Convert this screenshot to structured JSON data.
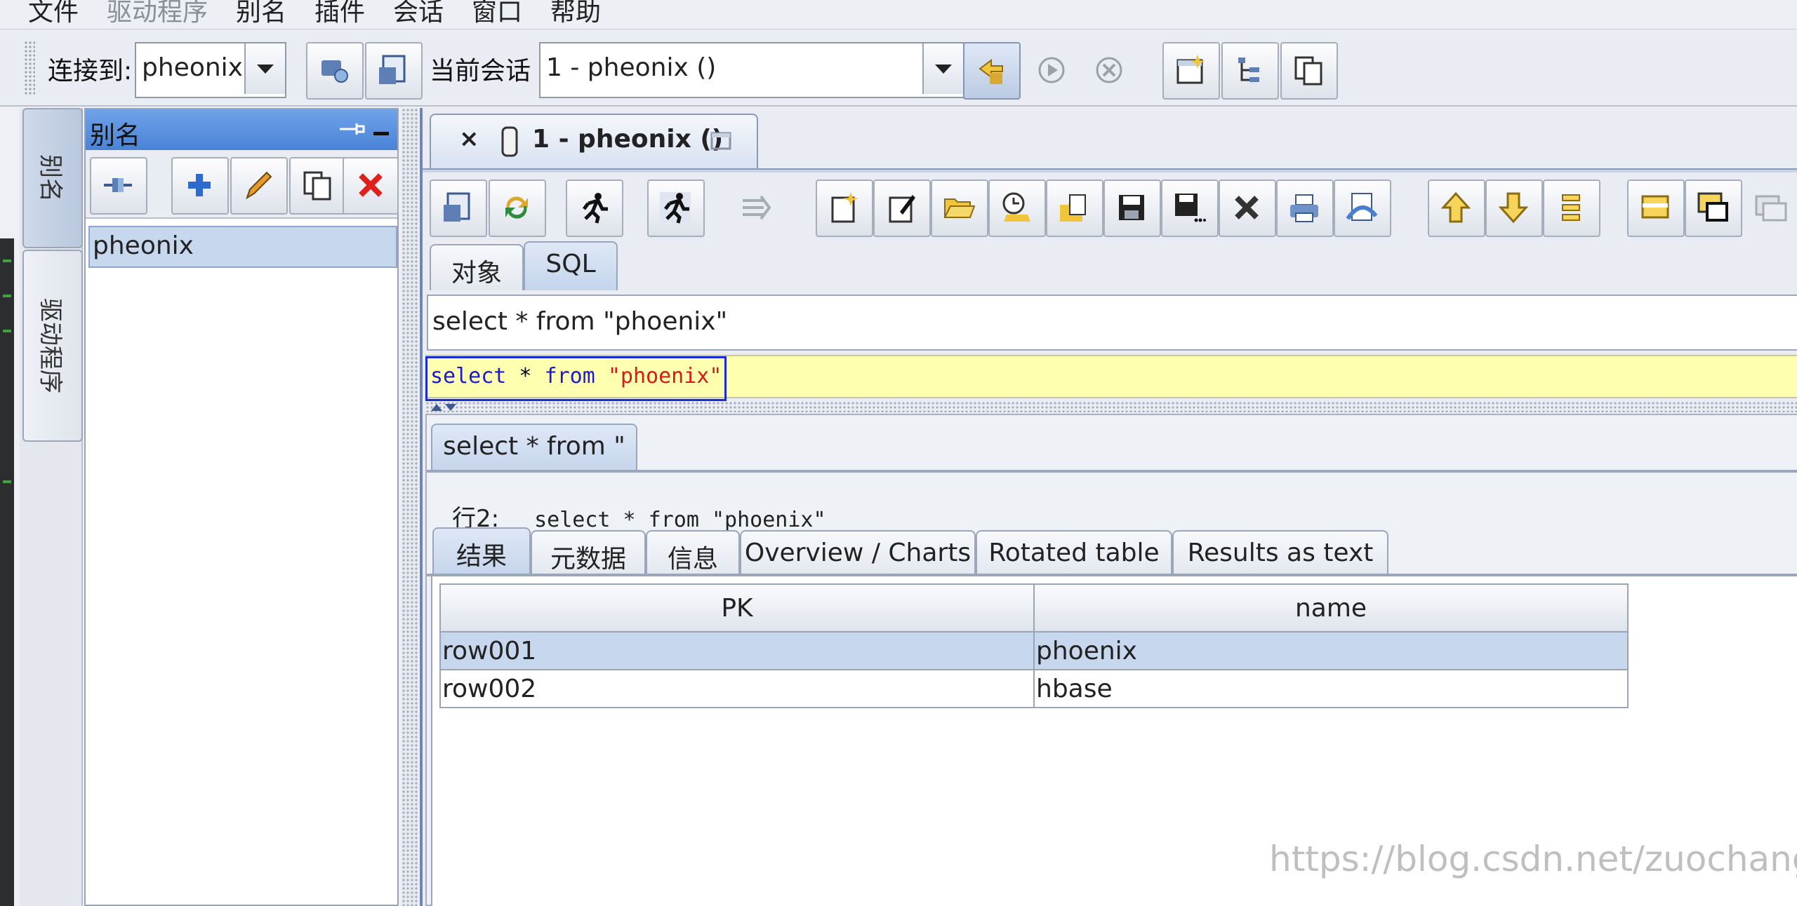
{
  "menubar": {
    "items": [
      "文件",
      "驱动程序",
      "别名",
      "插件",
      "会话",
      "窗口",
      "帮助"
    ]
  },
  "toolbar": {
    "connect_label": "连接到:",
    "connect_value": "pheonix",
    "session_label": "当前会话",
    "session_value": "1 - pheonix ()"
  },
  "left_tabs": {
    "alias": "别名",
    "drivers": "驱动程序"
  },
  "alias_panel": {
    "title": "别名",
    "items": [
      "pheonix"
    ]
  },
  "session_tab": {
    "close": "×",
    "title": "1 - pheonix ()"
  },
  "main_tabs": [
    "对象",
    "SQL"
  ],
  "sql_history": "select * from \"phoenix\"",
  "editor": {
    "kw1": "select",
    "op": " * ",
    "kw2": "from",
    "str": " \"phoenix\""
  },
  "result_tab": "select * from \"",
  "row_info": {
    "label": "行2:",
    "sql": "select * from \"phoenix\""
  },
  "result_tabs": [
    "结果",
    "元数据",
    "信息",
    "Overview / Charts",
    "Rotated table",
    "Results as text"
  ],
  "table": {
    "columns": [
      "PK",
      "name"
    ],
    "rows": [
      [
        "row001",
        "phoenix"
      ],
      [
        "row002",
        "hbase"
      ]
    ]
  },
  "watermark": "https://blog.csdn.net/zuochang_liu"
}
